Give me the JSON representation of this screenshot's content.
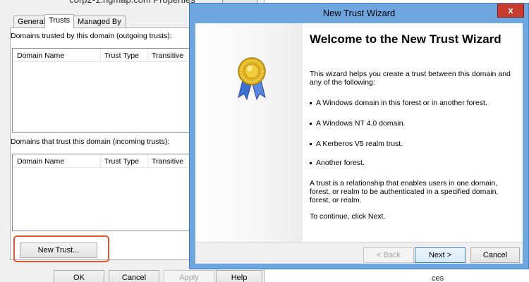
{
  "properties_dialog": {
    "title": "corp2-1.ngmap.com Properties",
    "tabs": [
      "General",
      "Trusts",
      "Managed By"
    ],
    "outgoing_label": "Domains trusted by this domain (outgoing trusts):",
    "incoming_label": "Domains that trust this domain (incoming trusts):",
    "columns": [
      "Domain Name",
      "Trust Type",
      "Transitive"
    ],
    "new_trust_button": "New Trust...",
    "buttons": {
      "ok": "OK",
      "cancel": "Cancel",
      "apply": "Apply",
      "help": "Help"
    }
  },
  "wizard": {
    "title": "New Trust Wizard",
    "close_label": "x",
    "heading": "Welcome to the New Trust Wizard",
    "intro": "This wizard helps you create a trust between this domain and any of the following:",
    "bullets": [
      "A Windows domain in this forest or in another forest.",
      "A Windows NT 4.0 domain.",
      "A Kerberos V5 realm trust.",
      "Another forest."
    ],
    "trust_definition": "A trust is a relationship that enables users in one domain, forest, or realm to be authenticated in a specified domain, forest, or realm.",
    "continue_text": "To continue, click Next.",
    "buttons": {
      "back": "< Back",
      "next": "Next >",
      "cancel": "Cancel"
    }
  },
  "background_partial_text": "ces",
  "colors": {
    "highlight": "#e4572e",
    "wizard_frame": "#6ea6e0",
    "close_button": "#c73c2f",
    "medal_gold": "#e0b21f",
    "ribbon_blue": "#3f6fd1"
  },
  "icons": [
    "medal-icon",
    "close-icon"
  ]
}
